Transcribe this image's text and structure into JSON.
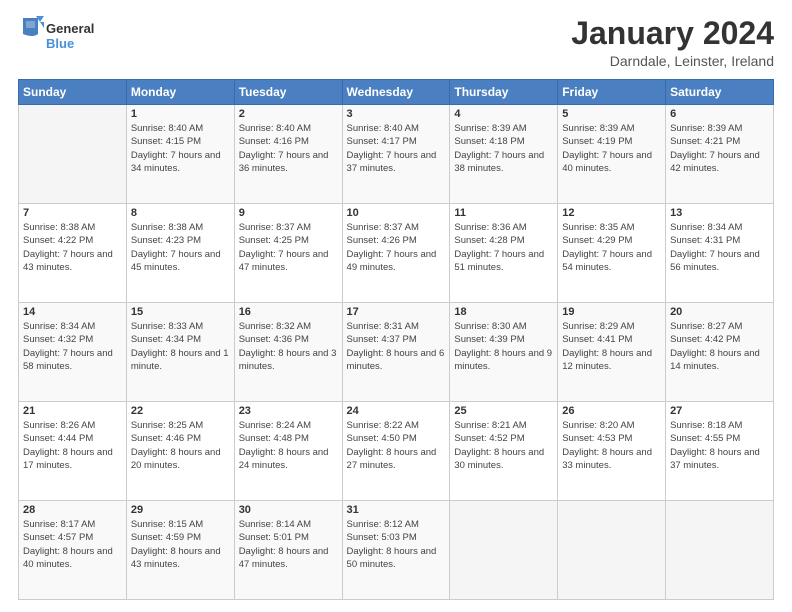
{
  "header": {
    "title": "January 2024",
    "location": "Darndale, Leinster, Ireland"
  },
  "weekdays": [
    "Sunday",
    "Monday",
    "Tuesday",
    "Wednesday",
    "Thursday",
    "Friday",
    "Saturday"
  ],
  "weeks": [
    [
      {
        "day": "",
        "sunrise": "",
        "sunset": "",
        "daylight": ""
      },
      {
        "day": "1",
        "sunrise": "Sunrise: 8:40 AM",
        "sunset": "Sunset: 4:15 PM",
        "daylight": "Daylight: 7 hours and 34 minutes."
      },
      {
        "day": "2",
        "sunrise": "Sunrise: 8:40 AM",
        "sunset": "Sunset: 4:16 PM",
        "daylight": "Daylight: 7 hours and 36 minutes."
      },
      {
        "day": "3",
        "sunrise": "Sunrise: 8:40 AM",
        "sunset": "Sunset: 4:17 PM",
        "daylight": "Daylight: 7 hours and 37 minutes."
      },
      {
        "day": "4",
        "sunrise": "Sunrise: 8:39 AM",
        "sunset": "Sunset: 4:18 PM",
        "daylight": "Daylight: 7 hours and 38 minutes."
      },
      {
        "day": "5",
        "sunrise": "Sunrise: 8:39 AM",
        "sunset": "Sunset: 4:19 PM",
        "daylight": "Daylight: 7 hours and 40 minutes."
      },
      {
        "day": "6",
        "sunrise": "Sunrise: 8:39 AM",
        "sunset": "Sunset: 4:21 PM",
        "daylight": "Daylight: 7 hours and 42 minutes."
      }
    ],
    [
      {
        "day": "7",
        "sunrise": "Sunrise: 8:38 AM",
        "sunset": "Sunset: 4:22 PM",
        "daylight": "Daylight: 7 hours and 43 minutes."
      },
      {
        "day": "8",
        "sunrise": "Sunrise: 8:38 AM",
        "sunset": "Sunset: 4:23 PM",
        "daylight": "Daylight: 7 hours and 45 minutes."
      },
      {
        "day": "9",
        "sunrise": "Sunrise: 8:37 AM",
        "sunset": "Sunset: 4:25 PM",
        "daylight": "Daylight: 7 hours and 47 minutes."
      },
      {
        "day": "10",
        "sunrise": "Sunrise: 8:37 AM",
        "sunset": "Sunset: 4:26 PM",
        "daylight": "Daylight: 7 hours and 49 minutes."
      },
      {
        "day": "11",
        "sunrise": "Sunrise: 8:36 AM",
        "sunset": "Sunset: 4:28 PM",
        "daylight": "Daylight: 7 hours and 51 minutes."
      },
      {
        "day": "12",
        "sunrise": "Sunrise: 8:35 AM",
        "sunset": "Sunset: 4:29 PM",
        "daylight": "Daylight: 7 hours and 54 minutes."
      },
      {
        "day": "13",
        "sunrise": "Sunrise: 8:34 AM",
        "sunset": "Sunset: 4:31 PM",
        "daylight": "Daylight: 7 hours and 56 minutes."
      }
    ],
    [
      {
        "day": "14",
        "sunrise": "Sunrise: 8:34 AM",
        "sunset": "Sunset: 4:32 PM",
        "daylight": "Daylight: 7 hours and 58 minutes."
      },
      {
        "day": "15",
        "sunrise": "Sunrise: 8:33 AM",
        "sunset": "Sunset: 4:34 PM",
        "daylight": "Daylight: 8 hours and 1 minute."
      },
      {
        "day": "16",
        "sunrise": "Sunrise: 8:32 AM",
        "sunset": "Sunset: 4:36 PM",
        "daylight": "Daylight: 8 hours and 3 minutes."
      },
      {
        "day": "17",
        "sunrise": "Sunrise: 8:31 AM",
        "sunset": "Sunset: 4:37 PM",
        "daylight": "Daylight: 8 hours and 6 minutes."
      },
      {
        "day": "18",
        "sunrise": "Sunrise: 8:30 AM",
        "sunset": "Sunset: 4:39 PM",
        "daylight": "Daylight: 8 hours and 9 minutes."
      },
      {
        "day": "19",
        "sunrise": "Sunrise: 8:29 AM",
        "sunset": "Sunset: 4:41 PM",
        "daylight": "Daylight: 8 hours and 12 minutes."
      },
      {
        "day": "20",
        "sunrise": "Sunrise: 8:27 AM",
        "sunset": "Sunset: 4:42 PM",
        "daylight": "Daylight: 8 hours and 14 minutes."
      }
    ],
    [
      {
        "day": "21",
        "sunrise": "Sunrise: 8:26 AM",
        "sunset": "Sunset: 4:44 PM",
        "daylight": "Daylight: 8 hours and 17 minutes."
      },
      {
        "day": "22",
        "sunrise": "Sunrise: 8:25 AM",
        "sunset": "Sunset: 4:46 PM",
        "daylight": "Daylight: 8 hours and 20 minutes."
      },
      {
        "day": "23",
        "sunrise": "Sunrise: 8:24 AM",
        "sunset": "Sunset: 4:48 PM",
        "daylight": "Daylight: 8 hours and 24 minutes."
      },
      {
        "day": "24",
        "sunrise": "Sunrise: 8:22 AM",
        "sunset": "Sunset: 4:50 PM",
        "daylight": "Daylight: 8 hours and 27 minutes."
      },
      {
        "day": "25",
        "sunrise": "Sunrise: 8:21 AM",
        "sunset": "Sunset: 4:52 PM",
        "daylight": "Daylight: 8 hours and 30 minutes."
      },
      {
        "day": "26",
        "sunrise": "Sunrise: 8:20 AM",
        "sunset": "Sunset: 4:53 PM",
        "daylight": "Daylight: 8 hours and 33 minutes."
      },
      {
        "day": "27",
        "sunrise": "Sunrise: 8:18 AM",
        "sunset": "Sunset: 4:55 PM",
        "daylight": "Daylight: 8 hours and 37 minutes."
      }
    ],
    [
      {
        "day": "28",
        "sunrise": "Sunrise: 8:17 AM",
        "sunset": "Sunset: 4:57 PM",
        "daylight": "Daylight: 8 hours and 40 minutes."
      },
      {
        "day": "29",
        "sunrise": "Sunrise: 8:15 AM",
        "sunset": "Sunset: 4:59 PM",
        "daylight": "Daylight: 8 hours and 43 minutes."
      },
      {
        "day": "30",
        "sunrise": "Sunrise: 8:14 AM",
        "sunset": "Sunset: 5:01 PM",
        "daylight": "Daylight: 8 hours and 47 minutes."
      },
      {
        "day": "31",
        "sunrise": "Sunrise: 8:12 AM",
        "sunset": "Sunset: 5:03 PM",
        "daylight": "Daylight: 8 hours and 50 minutes."
      },
      {
        "day": "",
        "sunrise": "",
        "sunset": "",
        "daylight": ""
      },
      {
        "day": "",
        "sunrise": "",
        "sunset": "",
        "daylight": ""
      },
      {
        "day": "",
        "sunrise": "",
        "sunset": "",
        "daylight": ""
      }
    ]
  ]
}
